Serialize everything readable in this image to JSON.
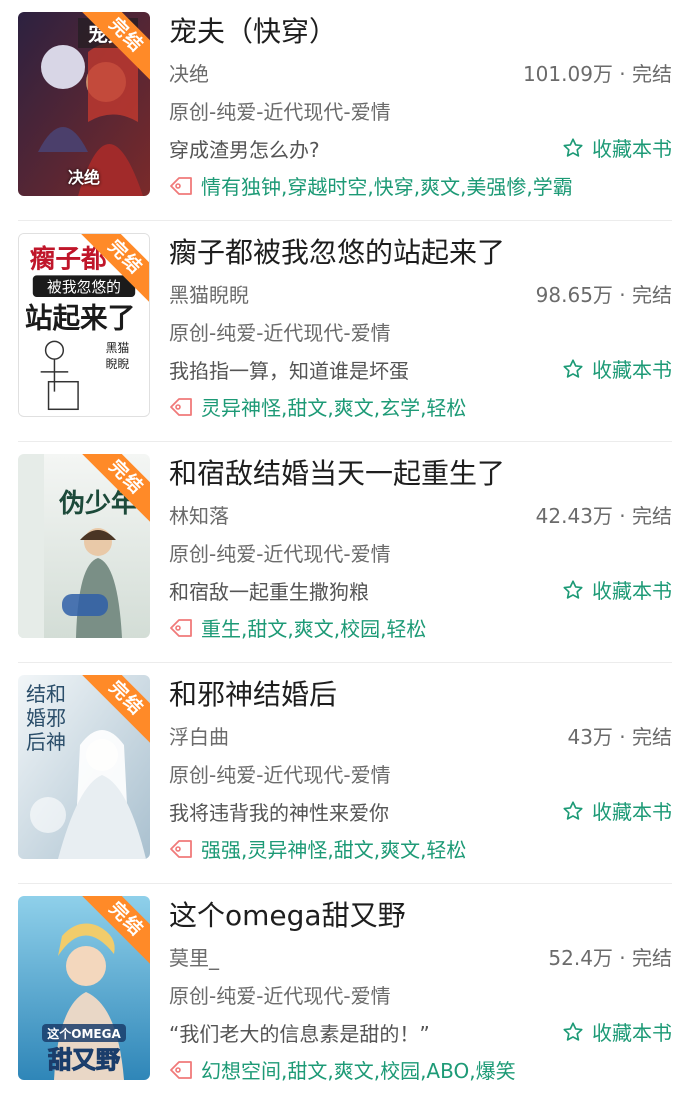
{
  "books": [
    {
      "title": "宠夫（快穿）",
      "author": "决绝",
      "stats": "101.09万 · 完结",
      "category": "原创-纯爱-近代现代-爱情",
      "intro": "穿成渣男怎么办?",
      "favorite_label": "收藏本书",
      "tags": "情有独钟,穿越时空,快穿,爽文,美强惨,学霸",
      "ribbon": "完结",
      "cover_text": "决绝",
      "cover_colors": [
        "#3b2a4a",
        "#8b2c2c"
      ]
    },
    {
      "title": "瘸子都被我忽悠的站起来了",
      "author": "黑猫睨睨",
      "stats": "98.65万 · 完结",
      "category": "原创-纯爱-近代现代-爱情",
      "intro": "我掐指一算，知道谁是坏蛋",
      "favorite_label": "收藏本书",
      "tags": "灵异神怪,甜文,爽文,玄学,轻松",
      "ribbon": "完结",
      "cover_text": "",
      "cover_colors": [
        "#ffffff",
        "#f3f3f3"
      ]
    },
    {
      "title": "和宿敌结婚当天一起重生了",
      "author": "林知落",
      "stats": "42.43万 · 完结",
      "category": "原创-纯爱-近代现代-爱情",
      "intro": "和宿敌一起重生撒狗粮",
      "favorite_label": "收藏本书",
      "tags": "重生,甜文,爽文,校园,轻松",
      "ribbon": "完结",
      "cover_text": "",
      "cover_colors": [
        "#eef2ef",
        "#cfd9d3"
      ]
    },
    {
      "title": "和邪神结婚后",
      "author": "浮白曲",
      "stats": "43万 · 完结",
      "category": "原创-纯爱-近代现代-爱情",
      "intro": "我将违背我的神性来爱你",
      "favorite_label": "收藏本书",
      "tags": "强强,灵异神怪,甜文,爽文,轻松",
      "ribbon": "完结",
      "cover_text": "",
      "cover_colors": [
        "#e6eef2",
        "#b9cbd6"
      ]
    },
    {
      "title": "这个omega甜又野",
      "author": "莫里_",
      "stats": "52.4万 · 完结",
      "category": "原创-纯爱-近代现代-爱情",
      "intro": "“我们老大的信息素是甜的！”",
      "favorite_label": "收藏本书",
      "tags": "幻想空间,甜文,爽文,校园,ABO,爆笑",
      "ribbon": "完结",
      "cover_text": "",
      "cover_colors": [
        "#5ab7e0",
        "#f2c27a"
      ]
    }
  ],
  "colors": {
    "accent": "#1d9a76",
    "ribbon": "#ff8a28",
    "tag_icon": "#f07a7a"
  },
  "icons": {
    "favorite": "star-outline-icon",
    "tag": "tag-icon"
  }
}
